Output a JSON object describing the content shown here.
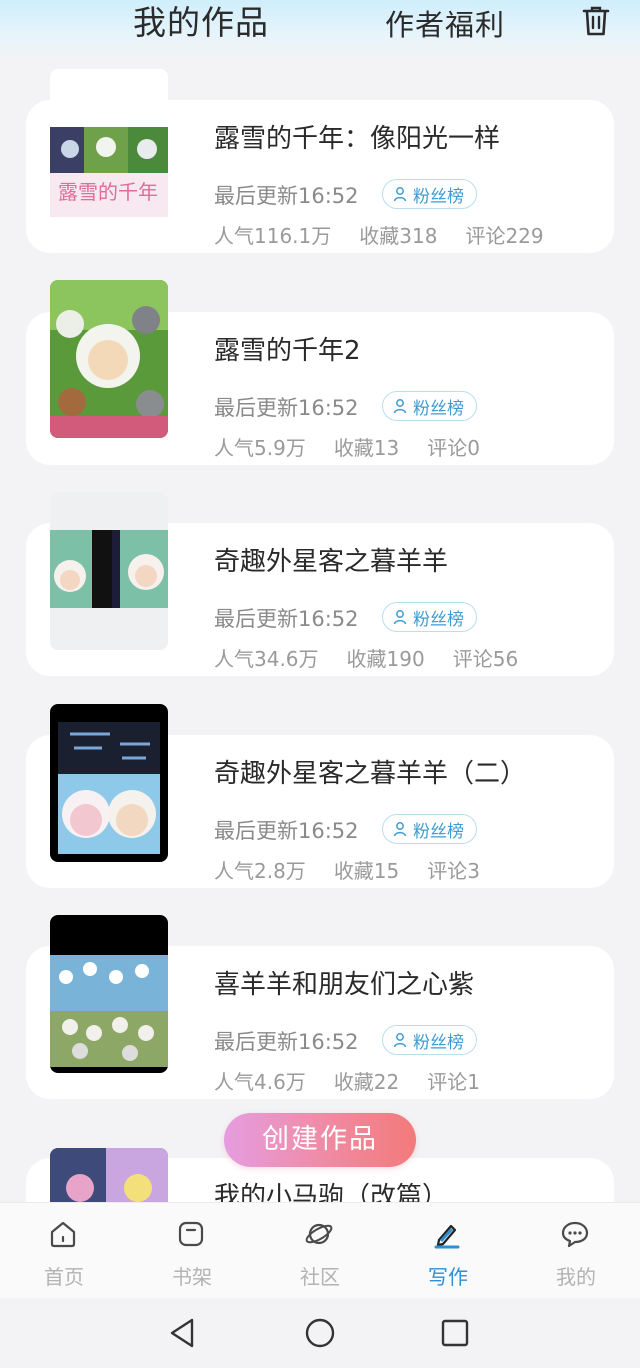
{
  "header": {
    "title": "我的作品",
    "benefit": "作者福利"
  },
  "works": [
    {
      "title": "露雪的千年：像阳光一样",
      "updated": "最后更新16:52",
      "fan_label": "粉丝榜",
      "popularity": "人气116.1万",
      "favorites": "收藏318",
      "comments": "评论229"
    },
    {
      "title": "露雪的千年2",
      "updated": "最后更新16:52",
      "fan_label": "粉丝榜",
      "popularity": "人气5.9万",
      "favorites": "收藏13",
      "comments": "评论0"
    },
    {
      "title": "奇趣外星客之暮羊羊",
      "updated": "最后更新16:52",
      "fan_label": "粉丝榜",
      "popularity": "人气34.6万",
      "favorites": "收藏190",
      "comments": "评论56"
    },
    {
      "title": "奇趣外星客之暮羊羊（二）",
      "updated": "最后更新16:52",
      "fan_label": "粉丝榜",
      "popularity": "人气2.8万",
      "favorites": "收藏15",
      "comments": "评论3"
    },
    {
      "title": "喜羊羊和朋友们之心紫",
      "updated": "最后更新16:52",
      "fan_label": "粉丝榜",
      "popularity": "人气4.6万",
      "favorites": "收藏22",
      "comments": "评论1"
    },
    {
      "title": "我的小马驹（改篇）"
    }
  ],
  "create_button": "创建作品",
  "tabbar": [
    {
      "label": "首页",
      "icon": "home-icon"
    },
    {
      "label": "书架",
      "icon": "bookshelf-icon"
    },
    {
      "label": "社区",
      "icon": "planet-icon"
    },
    {
      "label": "写作",
      "icon": "pen-icon",
      "active": true
    },
    {
      "label": "我的",
      "icon": "chat-bubble-icon"
    }
  ],
  "colors": {
    "accent": "#2f8fd0",
    "fan_badge": "#3f9bd0",
    "create_start": "#e59de0",
    "create_end": "#f27a7a"
  }
}
